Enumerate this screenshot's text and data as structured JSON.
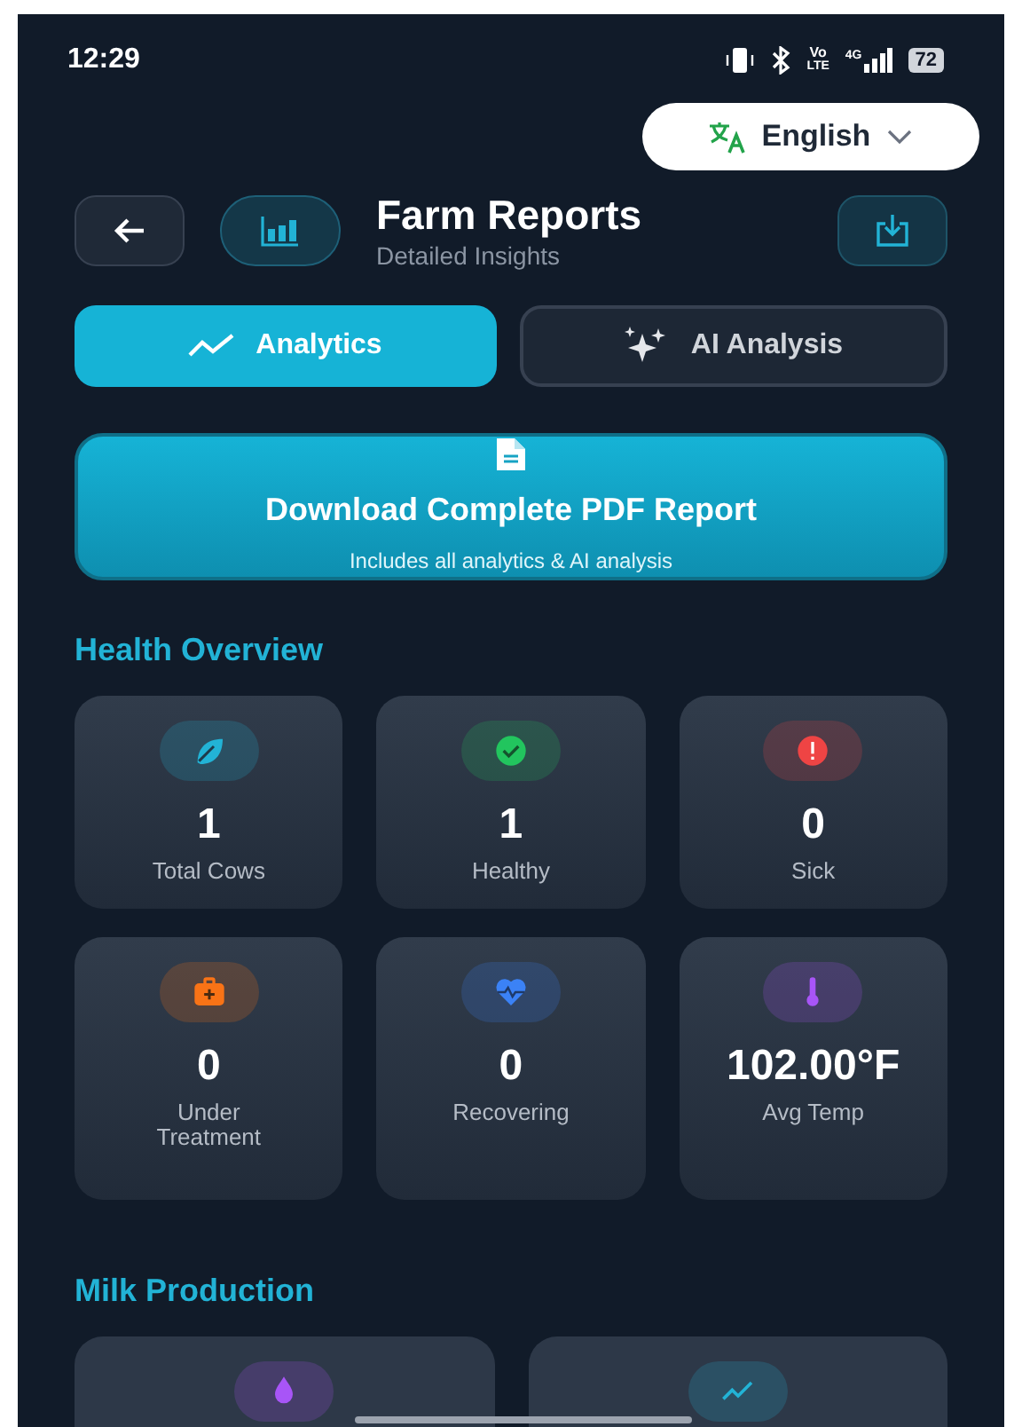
{
  "status_bar": {
    "time": "12:29",
    "volte_top": "Vo",
    "volte_bottom": "LTE",
    "network": "4G",
    "battery": "72"
  },
  "language": {
    "label": "English"
  },
  "header": {
    "title": "Farm Reports",
    "subtitle": "Detailed Insights"
  },
  "tabs": [
    {
      "label": "Analytics",
      "kind": "chart",
      "selected": true
    },
    {
      "label": "AI Analysis",
      "kind": "sparkle",
      "selected": false
    }
  ],
  "pdf_card": {
    "title": "Download Complete PDF Report",
    "subtitle": "Includes all analytics & AI analysis"
  },
  "health": {
    "heading": "Health Overview",
    "stats": [
      {
        "value": "1",
        "label": "Total Cows",
        "kind": "leaf",
        "color": "#22b3d6"
      },
      {
        "value": "1",
        "label": "Healthy",
        "kind": "check",
        "color": "#22c55e"
      },
      {
        "value": "0",
        "label": "Sick",
        "kind": "alert",
        "color": "#ef4444"
      },
      {
        "value": "0",
        "label": "Under Treatment",
        "kind": "medkit",
        "color": "#f97316"
      },
      {
        "value": "0",
        "label": "Recovering",
        "kind": "heart",
        "color": "#3b82f6"
      },
      {
        "value": "102.00°F",
        "label": "Avg Temp",
        "kind": "thermo",
        "color": "#a855f7"
      }
    ]
  },
  "milk": {
    "heading": "Milk Production",
    "cards": [
      {
        "kind": "drop",
        "color": "#a855f7"
      },
      {
        "kind": "trend",
        "color": "#22b3d6"
      }
    ]
  }
}
